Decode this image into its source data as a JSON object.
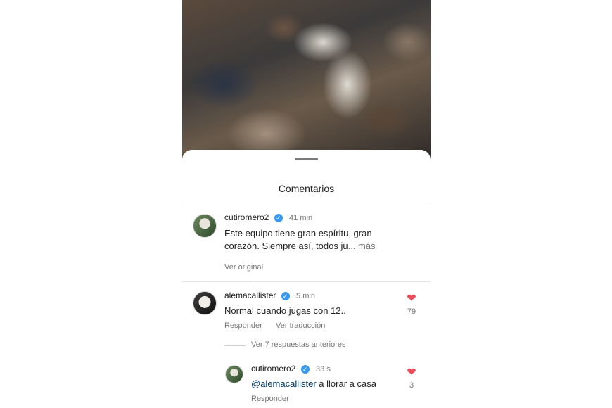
{
  "sheet": {
    "title": "Comentarios"
  },
  "caption": {
    "username": "cutiromero2",
    "time": "41 min",
    "text_line1": "Este equipo tiene gran espíritu, gran",
    "text_line2": "corazón. Siempre así, todos ju",
    "more": "... más",
    "see_original": "Ver original"
  },
  "comment": {
    "username": "alemacallister",
    "time": "5 min",
    "text": "Normal cuando jugas con 12..",
    "reply_label": "Responder",
    "translate_label": "Ver traducción",
    "likes": "79"
  },
  "view_previous": "Ver 7 respuestas anteriores",
  "reply": {
    "username": "cutiromero2",
    "time": "33 s",
    "mention": "@alemacallister",
    "text": " a llorar a casa",
    "reply_label": "Responder",
    "likes": "3"
  },
  "icons": {
    "verified": "verified-badge-icon",
    "heart": "heart-filled-icon"
  },
  "colors": {
    "verified": "#3897f0",
    "heart": "#ed4956",
    "mention": "#00376b"
  }
}
